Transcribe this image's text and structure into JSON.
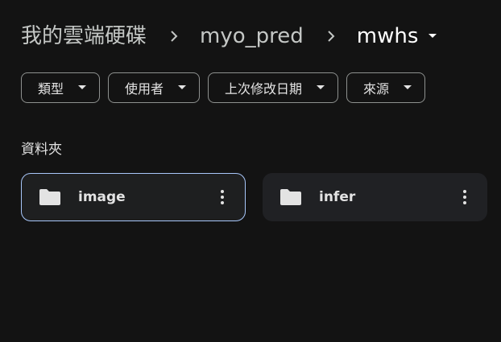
{
  "breadcrumb": {
    "root": "我的雲端硬碟",
    "parent": "myo_pred",
    "current": "mwhs",
    "separator_icon": "chevron-right-icon",
    "current_menu_icon": "caret-down-icon"
  },
  "filters": [
    {
      "label": "類型",
      "icon": "caret-down-icon"
    },
    {
      "label": "使用者",
      "icon": "caret-down-icon"
    },
    {
      "label": "上次修改日期",
      "icon": "caret-down-icon"
    },
    {
      "label": "來源",
      "icon": "caret-down-icon"
    }
  ],
  "section_title": "資料夾",
  "folders": [
    {
      "name": "image",
      "icon": "folder-icon",
      "menu_icon": "more-vert-icon",
      "selected": true
    },
    {
      "name": "infer",
      "icon": "folder-icon",
      "menu_icon": "more-vert-icon",
      "selected": false
    }
  ],
  "colors": {
    "background": "#131313",
    "card": "#202124",
    "selected_border": "#a8c7fa",
    "text": "#e3e3e3",
    "chip_border": "#8e918f"
  }
}
